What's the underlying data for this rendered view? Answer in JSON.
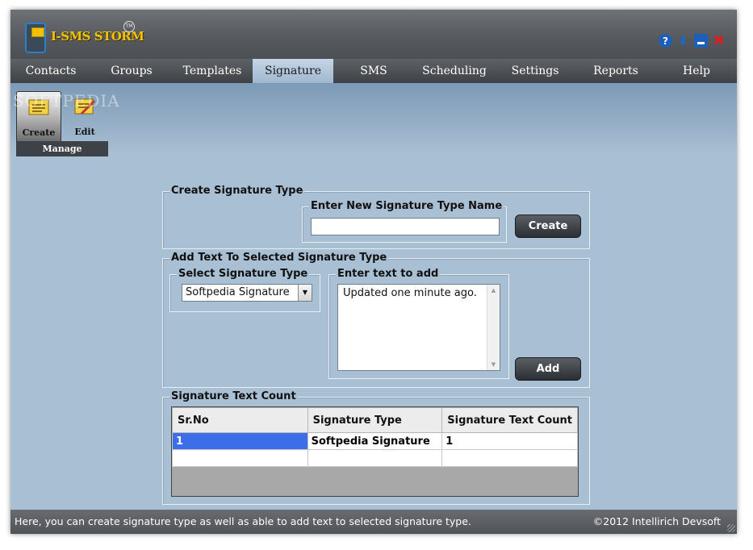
{
  "app": {
    "logo_text": "I-SMS STORM",
    "logo_tm": "TM",
    "watermark": "SOFTPEDIA"
  },
  "window_controls": {
    "help_icon": "help-icon",
    "download_icon": "download-arrow-icon",
    "minimize_icon": "minimize-icon",
    "close_icon": "close-icon",
    "help_glyph": "?",
    "download_glyph": "⬇",
    "close_glyph": "✖"
  },
  "menu": {
    "items": [
      {
        "label": "Contacts"
      },
      {
        "label": "Groups"
      },
      {
        "label": "Templates"
      },
      {
        "label": "Signature",
        "active": true
      },
      {
        "label": "SMS"
      },
      {
        "label": "Scheduling"
      },
      {
        "label": "Settings"
      },
      {
        "label": "Reports"
      },
      {
        "label": "Help"
      }
    ]
  },
  "ribbon": {
    "group_label": "Manage",
    "create_label": "Create",
    "edit_label": "Edit"
  },
  "create_type": {
    "legend": "Create Signature Type",
    "field_legend": "Enter New Signature Type Name",
    "field_value": "",
    "button": "Create"
  },
  "add_text": {
    "legend": "Add Text To Selected Signature Type",
    "select_legend": "Select Signature Type",
    "selected_value": "Softpedia Signature",
    "text_legend": "Enter text to add",
    "text_value": "Updated one minute ago.",
    "button": "Add"
  },
  "count": {
    "legend": "Signature Text Count",
    "columns": [
      "Sr.No",
      "Signature Type",
      "Signature Text Count"
    ],
    "rows": [
      [
        "1",
        "Softpedia Signature",
        "1"
      ],
      [
        "",
        "",
        ""
      ]
    ]
  },
  "status": {
    "message": "Here, you can create signature type as well as able to add text to selected signature type.",
    "copyright": "©2012 Intellirich Devsoft"
  },
  "colors": {
    "accent_logo": "#f2c100",
    "selected_row": "#3b6ee8",
    "window_bg": "#a9bfd3"
  }
}
